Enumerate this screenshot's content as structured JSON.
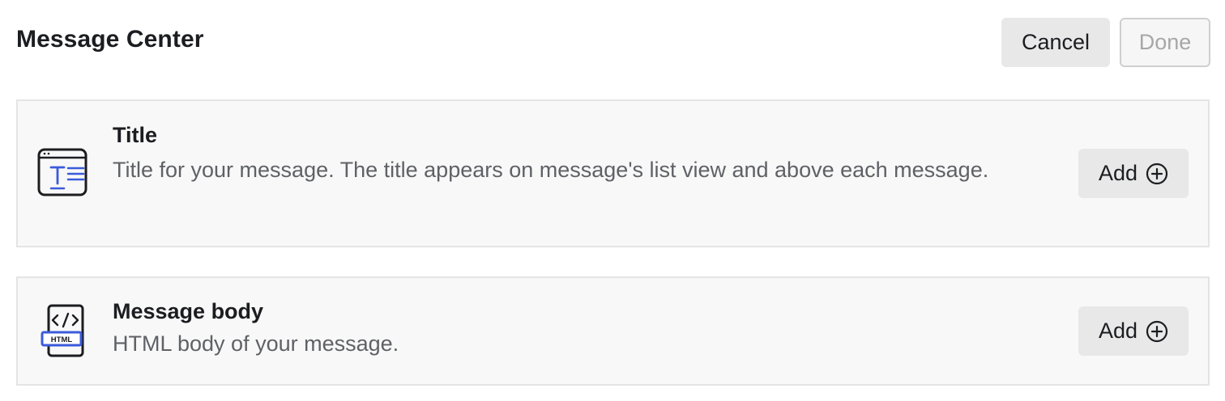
{
  "header": {
    "title": "Message Center",
    "cancel_label": "Cancel",
    "done_label": "Done"
  },
  "sections": [
    {
      "title": "Title",
      "description": "Title for your message. The title appears on message's list view and above each message.",
      "icon": "text-window-icon",
      "add_label": "Add"
    },
    {
      "title": "Message body",
      "description": "HTML body of your message.",
      "icon": "html-code-icon",
      "icon_badge": "HTML",
      "add_label": "Add"
    }
  ],
  "colors": {
    "accent": "#3b5bdb",
    "text_primary": "#1c1d21",
    "text_secondary": "#5f6166",
    "card_background": "#f8f8f8",
    "button_background": "#e8e8e8",
    "disabled_text": "#a7a7a7"
  }
}
